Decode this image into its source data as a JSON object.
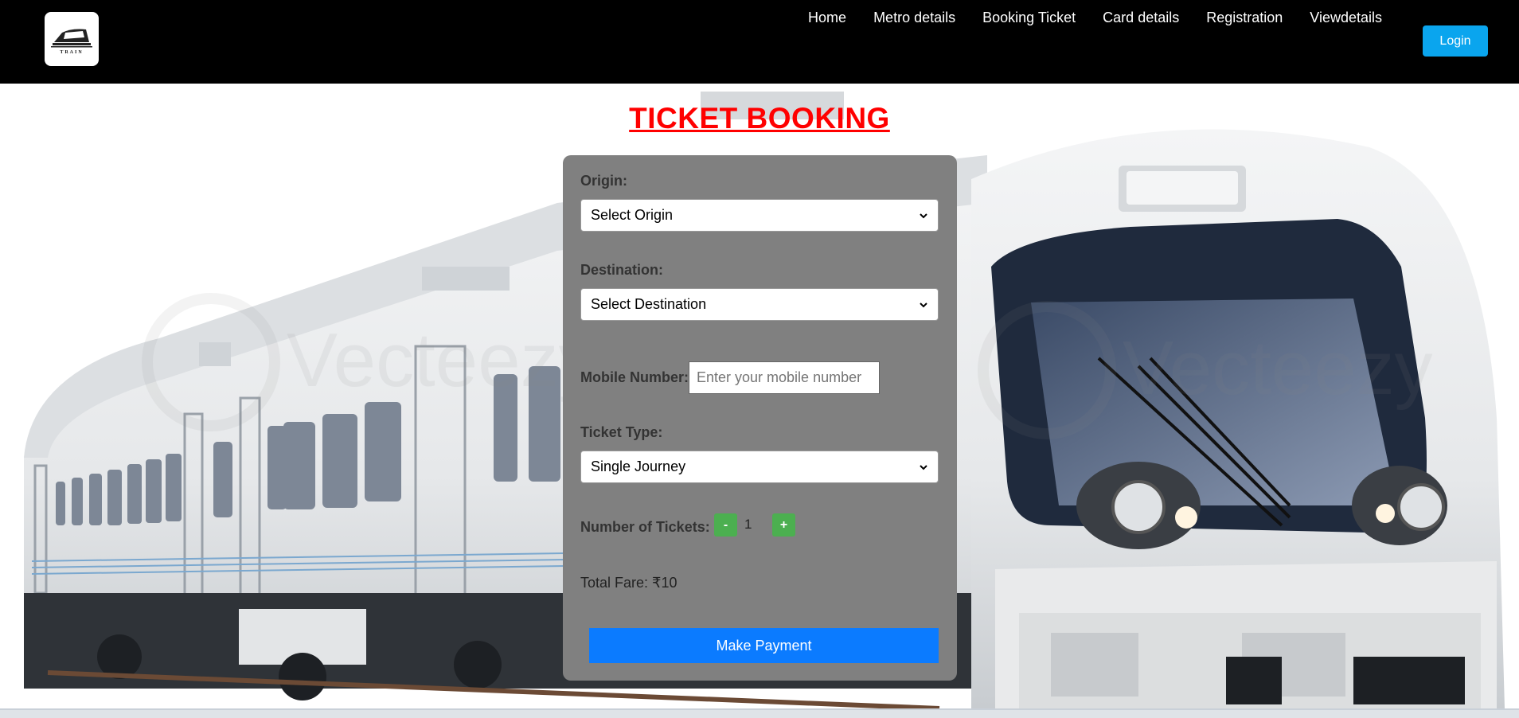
{
  "header": {
    "logo_text": "TRAIN",
    "nav": [
      "Home",
      "Metro details",
      "Booking Ticket",
      "Card details",
      "Registration",
      "Viewdetails"
    ],
    "login_label": "Login"
  },
  "page": {
    "title": "TICKET BOOKING"
  },
  "background": {
    "watermark": "Vecteezy"
  },
  "form": {
    "origin_label": "Origin:",
    "origin_value": "Select Origin",
    "destination_label": "Destination:",
    "destination_value": "Select Destination",
    "mobile_label": "Mobile Number:",
    "mobile_value": "",
    "mobile_placeholder": "Enter your mobile number",
    "ticket_type_label": "Ticket Type:",
    "ticket_type_value": "Single Journey",
    "num_tickets_label": "Number of Tickets:",
    "minus_label": "-",
    "plus_label": "+",
    "quantity": "1",
    "total_fare": "Total Fare: ₹10",
    "pay_label": "Make Payment"
  },
  "colors": {
    "title": "#ff0000",
    "card": "#808080",
    "login": "#0aa5ee",
    "stepper": "#4caf50",
    "pay_button": "#0b7bff"
  },
  "icons": [
    "train-logo-icon",
    "chevron-down-icon"
  ]
}
